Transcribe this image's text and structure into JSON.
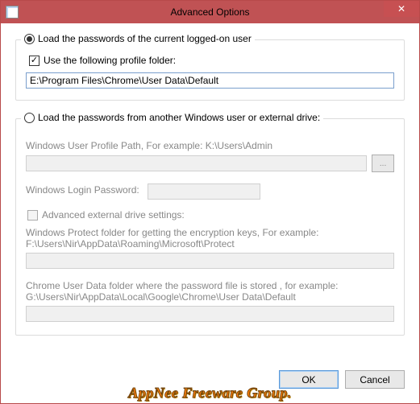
{
  "window": {
    "title": "Advanced Options"
  },
  "option1": {
    "radio_label": "Load the passwords of the current logged-on user",
    "radio_checked": true,
    "use_profile_label": "Use the following profile folder:",
    "use_profile_checked": true,
    "profile_path": "E:\\Program Files\\Chrome\\User Data\\Default"
  },
  "option2": {
    "radio_label": "Load the passwords from another Windows user or external drive:",
    "radio_checked": false,
    "user_profile_label": "Windows User Profile Path, For example: K:\\Users\\Admin",
    "user_profile_value": "",
    "browse_btn": "...",
    "login_pw_label": "Windows Login Password:",
    "login_pw_value": "",
    "adv_ext_label": "Advanced external drive settings:",
    "adv_ext_checked": false,
    "protect_label": "Windows Protect folder for getting the encryption keys, For example: F:\\Users\\Nir\\AppData\\Roaming\\Microsoft\\Protect",
    "protect_value": "",
    "userdata_label": "Chrome User Data folder where the password file is stored , for example: G:\\Users\\Nir\\AppData\\Local\\Google\\Chrome\\User Data\\Default",
    "userdata_value": ""
  },
  "buttons": {
    "ok": "OK",
    "cancel": "Cancel"
  },
  "watermark": "AppNee Freeware Group."
}
